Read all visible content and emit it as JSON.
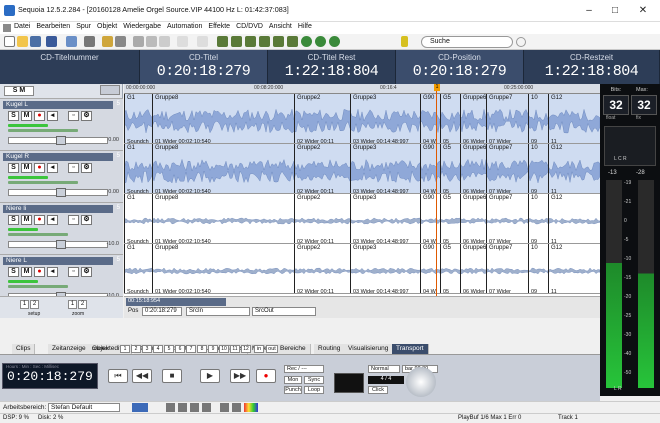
{
  "window": {
    "title": "Sequoia 12.5.2.284 - [20160128 Amelie Orgel Source.VIP  44100 Hz L: 01:42:37:083]"
  },
  "menu": [
    "Datei",
    "Bearbeiten",
    "Spur",
    "Objekt",
    "Wiedergabe",
    "Automation",
    "Effekte",
    "CD/DVD",
    "Ansicht",
    "Hilfe"
  ],
  "toolbar": {
    "search_placeholder": "Suche"
  },
  "display": {
    "fields": [
      {
        "label": "CD-Titelnummer",
        "value": ""
      },
      {
        "label": "CD-Titel",
        "value": "0:20:18:279"
      },
      {
        "label": "CD-Titel Rest",
        "value": "1:22:18:804"
      },
      {
        "label": "CD-Position",
        "value": "0:20:18:279"
      },
      {
        "label": "CD-Restzeit",
        "value": "1:22:18:804"
      }
    ]
  },
  "track_header": {
    "s_label": "S",
    "m_label": "M"
  },
  "tracks": [
    {
      "name": "Kugel L",
      "num": "5",
      "db": "0.00"
    },
    {
      "name": "Kugel R",
      "num": "5",
      "db": "0.00"
    },
    {
      "name": "Niere li",
      "num": "5",
      "db": "-10.0"
    },
    {
      "name": "Niere L",
      "num": "5",
      "db": "-10.0"
    }
  ],
  "ruler": {
    "ticks": [
      "00:00:00:000",
      "00:08:20:000",
      "00:16:4",
      "00:25:00:000"
    ],
    "marker": "1"
  },
  "clips": {
    "top_labels": [
      "G1",
      "Gruppe8",
      "Gruppe2",
      "Gruppe3",
      "G90",
      "G5",
      "Gruppe6",
      "Gruppe7",
      "10",
      "G12"
    ],
    "bottom_labels": [
      "Soundch",
      "01 Wider  00:02:10:540",
      "02 Wider  00:11",
      "03 Wider  00:14:48:997",
      "04 W",
      "05",
      "06 Wider",
      "07 Wider",
      "09",
      "11"
    ]
  },
  "position_bar": {
    "pos_label": "Pos",
    "pos_value": "0:20:18:279",
    "srcin": "SrcIn",
    "srcout": "SrcOut",
    "marker_time": "00:15:18:954",
    "setup": "setup",
    "zoom": "zoom"
  },
  "meters": {
    "bits_label": "Bits:",
    "max_label": "Max:",
    "bits": "32",
    "max": "32",
    "float_label": "float",
    "fix_label": "fix",
    "lr": "L  C  R",
    "peak_l": "-13",
    "peak_r": "-28",
    "scale": [
      "-19",
      "-21",
      "0",
      "-5",
      "-10",
      "-15",
      "-20",
      "-25",
      "-30",
      "-40",
      "-50"
    ],
    "bottom_lr": "L    R"
  },
  "tabs": [
    "Clips",
    "Zeitanzeige",
    "Objekteditor",
    "Dateien",
    "Objekte",
    "Spuren",
    "Takes",
    "Marker",
    "Bereiche",
    "Routing",
    "Visualisierung",
    "Transport"
  ],
  "transport": {
    "timecode": "0:20:18:279",
    "tc_header": "Hours : Min : Sec : Millisec",
    "marker_label": "marker",
    "marker_numbers": [
      "1",
      "2",
      "3",
      "4",
      "5",
      "6",
      "7",
      "8",
      "9",
      "10",
      "11",
      "12"
    ],
    "in_label": "in",
    "out_label": "out",
    "rec_label": "Rec / ---",
    "mon_label": "Mon",
    "sync_label": "Sync",
    "punch_label": "Punch",
    "loop_label": "Loop",
    "speed_label": "Normal",
    "bpm_label": "bar 98.00",
    "sig_label": "4 / 4",
    "click_label": "Click"
  },
  "bottom": {
    "workspace_label": "Arbeitsbereich:",
    "workspace_value": "Stefan Default"
  },
  "status": {
    "dsp": "DSP: 9 %",
    "disk": "Disk:  2 %",
    "playbuf": "PlayBuf 1/6  Max 1  Err 0",
    "track": "Track 1"
  }
}
